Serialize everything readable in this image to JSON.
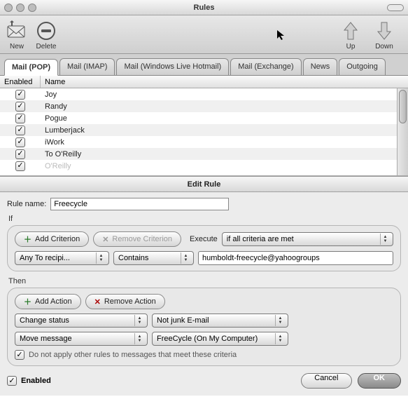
{
  "window": {
    "title": "Rules",
    "toolbar": {
      "new": "New",
      "delete": "Delete",
      "up": "Up",
      "down": "Down"
    },
    "tabs": [
      "Mail (POP)",
      "Mail (IMAP)",
      "Mail (Windows Live Hotmail)",
      "Mail (Exchange)",
      "News",
      "Outgoing"
    ],
    "active_tab": 0,
    "columns": {
      "enabled": "Enabled",
      "name": "Name"
    },
    "rules": [
      {
        "enabled": true,
        "name": "Joy"
      },
      {
        "enabled": true,
        "name": "Randy"
      },
      {
        "enabled": true,
        "name": "Pogue"
      },
      {
        "enabled": true,
        "name": "Lumberjack"
      },
      {
        "enabled": true,
        "name": "iWork"
      },
      {
        "enabled": true,
        "name": "To O'Reilly"
      },
      {
        "enabled": true,
        "name": "O'Reilly",
        "faded": true
      }
    ]
  },
  "dialog": {
    "title": "Edit Rule",
    "rule_name_label": "Rule name:",
    "rule_name_value": "Freecycle",
    "if_label": "If",
    "add_criterion": "Add Criterion",
    "remove_criterion": "Remove Criterion",
    "execute_label": "Execute",
    "execute_value": "if all criteria are met",
    "criterion_field": "Any To recipi...",
    "criterion_op": "Contains",
    "criterion_value": "humboldt-freecycle@yahoogroups",
    "then_label": "Then",
    "add_action": "Add Action",
    "remove_action": "Remove Action",
    "actions": [
      {
        "verb": "Change status",
        "value": "Not junk E-mail"
      },
      {
        "verb": "Move message",
        "value": "FreeCycle (On My Computer)"
      }
    ],
    "stop_rules_label": "Do not apply other rules to messages that meet these criteria",
    "stop_rules_checked": true,
    "enabled_label": "Enabled",
    "enabled_checked": true,
    "cancel": "Cancel",
    "ok": "OK"
  }
}
